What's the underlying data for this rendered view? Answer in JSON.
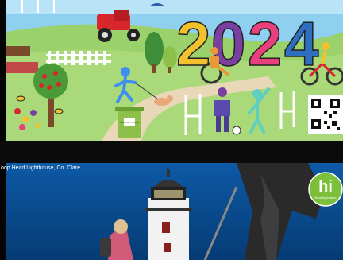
{
  "cards": [
    {
      "name": "illustration-2024",
      "year_text": "2024",
      "bin_label": "HEALTHY CLARE",
      "colors": {
        "sky": "#8fd0f1",
        "grass": "#9bd16a",
        "path": "#e8d8b8",
        "digit_2": "#f2c12e",
        "digit_0": "#7a3fa0",
        "digit_2b": "#e83f7d",
        "digit_4": "#2f6fc0"
      }
    },
    {
      "name": "lighthouse-photo",
      "caption": "oop Head Lighthouse, Co. Clare",
      "badge": {
        "text": "hi",
        "subtext": "Healthy Ireland"
      },
      "colors": {
        "sky": "#0a4a8c",
        "badge": "#7bbf3a"
      }
    }
  ]
}
